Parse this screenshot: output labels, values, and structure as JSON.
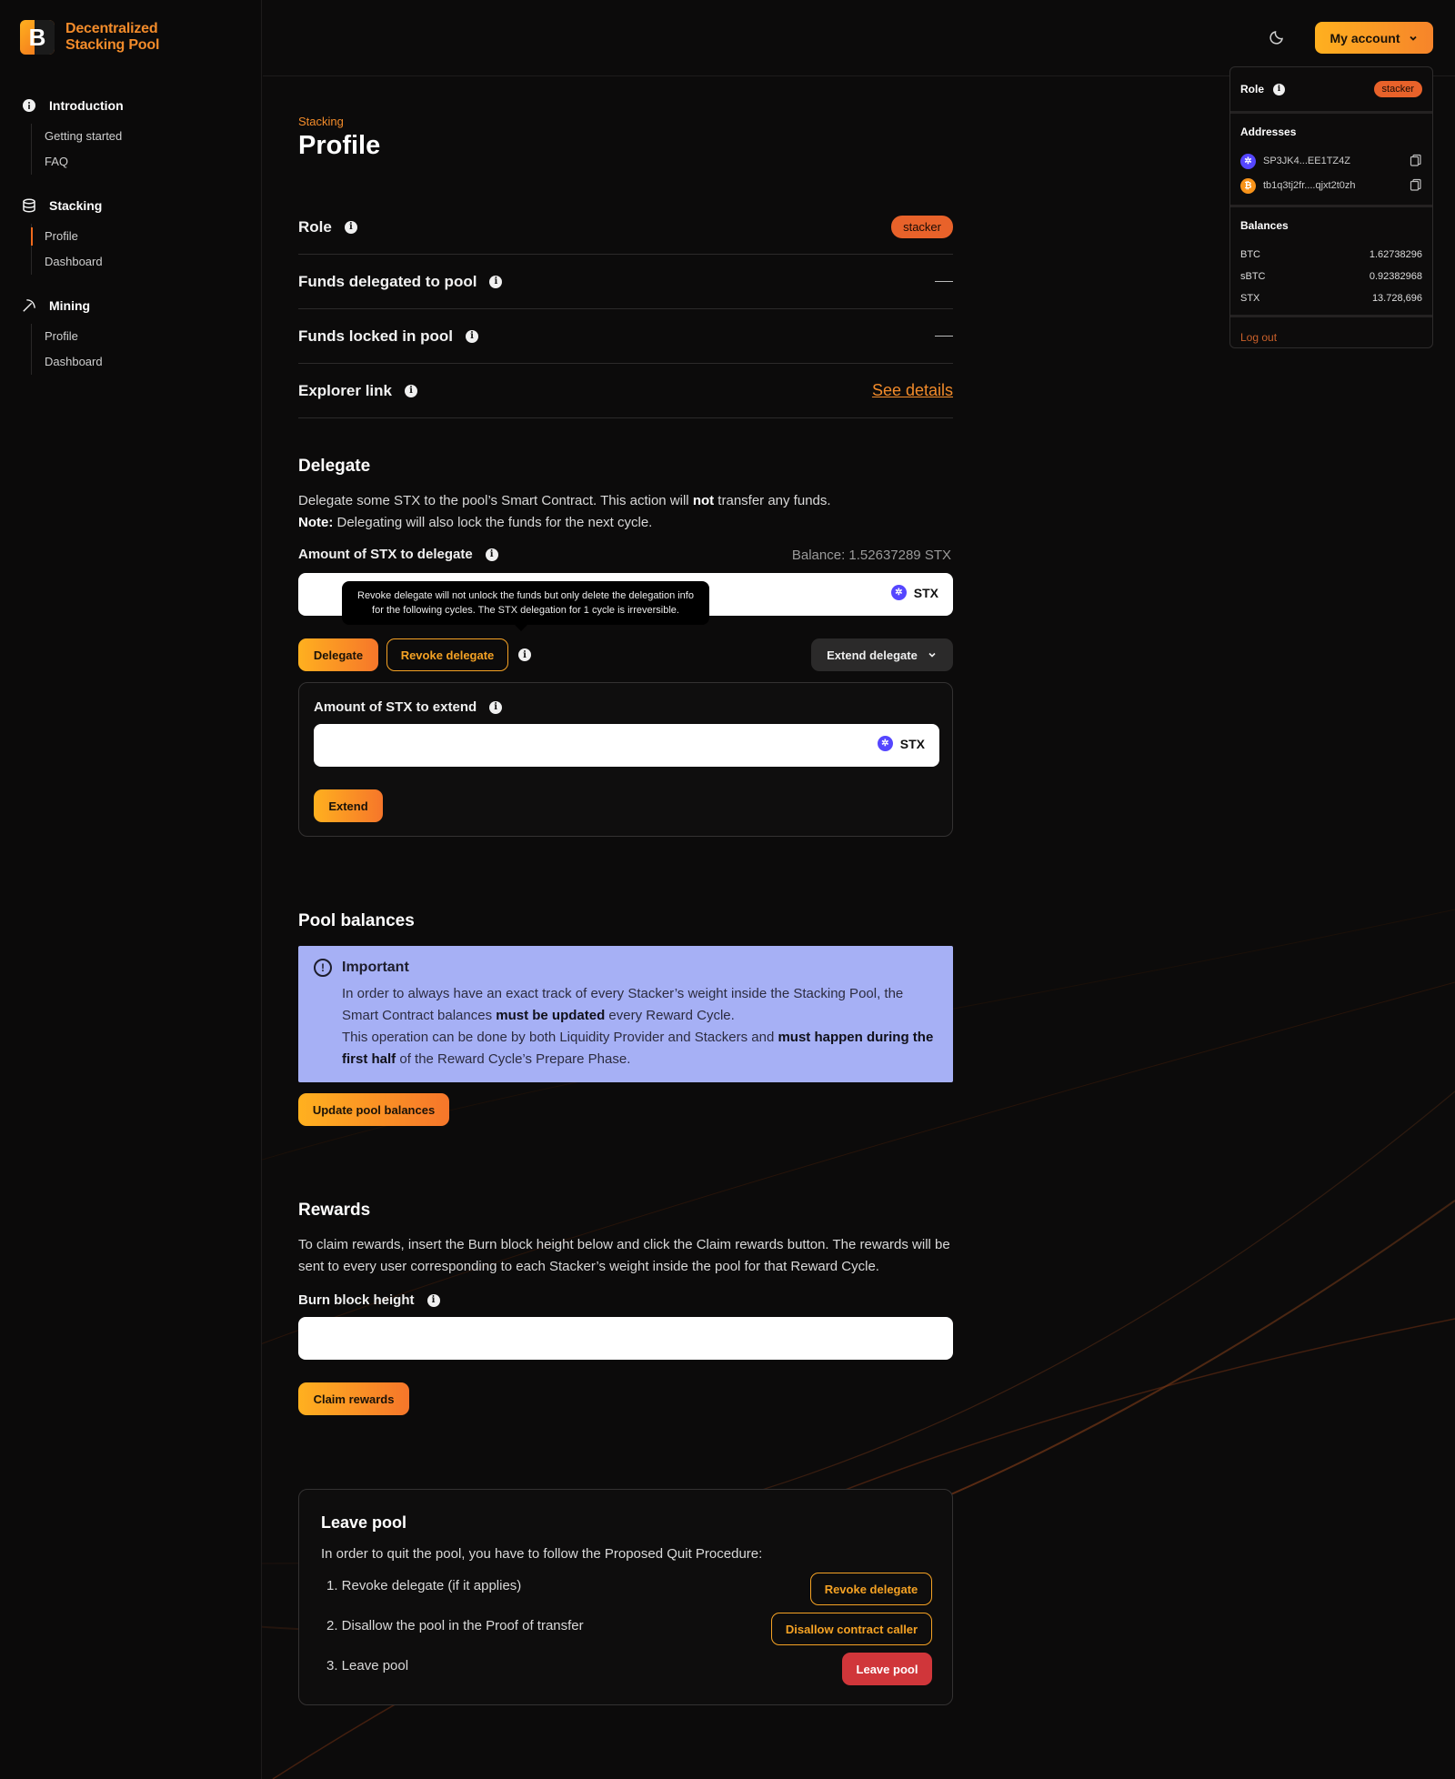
{
  "app": {
    "logo_letter": "B",
    "logo_line1": "Decentralized",
    "logo_line2": "Stacking Pool"
  },
  "sidebar": {
    "sections": [
      {
        "label": "Introduction",
        "icon": "info-icon",
        "items": [
          "Getting started",
          "FAQ"
        ]
      },
      {
        "label": "Stacking",
        "icon": "database-icon",
        "items": [
          "Profile",
          "Dashboard"
        ]
      },
      {
        "label": "Mining",
        "icon": "pickaxe-icon",
        "items": [
          "Profile",
          "Dashboard"
        ]
      }
    ]
  },
  "header": {
    "account_label": "My account",
    "theme_icon": "moon-icon"
  },
  "account_panel": {
    "role_label": "Role",
    "role_value": "stacker",
    "addresses_label": "Addresses",
    "stx_address": "SP3JK4...EE1TZ4Z",
    "btc_address": "tb1q3tj2fr....qjxt2t0zh",
    "balances_label": "Balances",
    "balances": [
      {
        "asset": "BTC",
        "amount": "1.62738296"
      },
      {
        "asset": "sBTC",
        "amount": "0.92382968"
      },
      {
        "asset": "STX",
        "amount": "13.728,696"
      }
    ],
    "logout_label": "Log out"
  },
  "page": {
    "breadcrumb": "Stacking",
    "title": "Profile"
  },
  "profile_rows": {
    "role_label": "Role",
    "role_value": "stacker",
    "delegated_label": "Funds delegated to pool",
    "locked_label": "Funds locked in pool",
    "explorer_label": "Explorer link",
    "explorer_value": "See details"
  },
  "delegate": {
    "title": "Delegate",
    "desc_1": "Delegate some STX to the pool’s Smart Contract. This action will ",
    "desc_bold": "not",
    "desc_2": " transfer any funds.",
    "note_bold": "Note:",
    "note_text": " Delegating will also lock the funds for the next cycle.",
    "amount_label": "Amount of STX to delegate",
    "balance_text": "Balance: 1.52637289 STX",
    "unit": "STX",
    "tooltip": "Revoke delegate will not unlock the funds but only delete the delegation info for the following cycles. The STX delegation for 1 cycle is irreversible.",
    "delegate_btn": "Delegate",
    "revoke_btn": "Revoke delegate",
    "extend_menu_btn": "Extend delegate",
    "extend_label": "Amount of STX to extend",
    "extend_unit": "STX",
    "extend_btn": "Extend"
  },
  "pool_balances": {
    "title": "Pool balances",
    "alert_title": "Important",
    "alert_1": "In order to always have an exact track of every Stacker’s weight inside the Stacking Pool, the Smart Contract balances ",
    "alert_1_bold": "must be updated",
    "alert_1_end": " every Reward Cycle.",
    "alert_2": "This operation can be done by both Liquidity Provider and Stackers and ",
    "alert_2_bold": "must happen during the first half",
    "alert_2_end": " of the Reward Cycle’s Prepare Phase.",
    "update_btn": "Update pool balances"
  },
  "rewards": {
    "title": "Rewards",
    "desc": "To claim rewards, insert the Burn block height below and click the Claim rewards button. The rewards will be sent to every user corresponding to each Stacker’s weight inside the pool for that Reward Cycle.",
    "height_label": "Burn block height",
    "claim_btn": "Claim rewards"
  },
  "leave": {
    "title": "Leave pool",
    "desc": "In order to quit the pool, you have to follow the Proposed Quit Procedure:",
    "step1": "1.  Revoke delegate (if it applies)",
    "step1_btn": "Revoke delegate",
    "step2": "2.  Disallow the pool in the Proof of transfer",
    "step2_btn": "Disallow contract caller",
    "step3": "3.  Leave pool",
    "step3_btn": "Leave pool"
  }
}
